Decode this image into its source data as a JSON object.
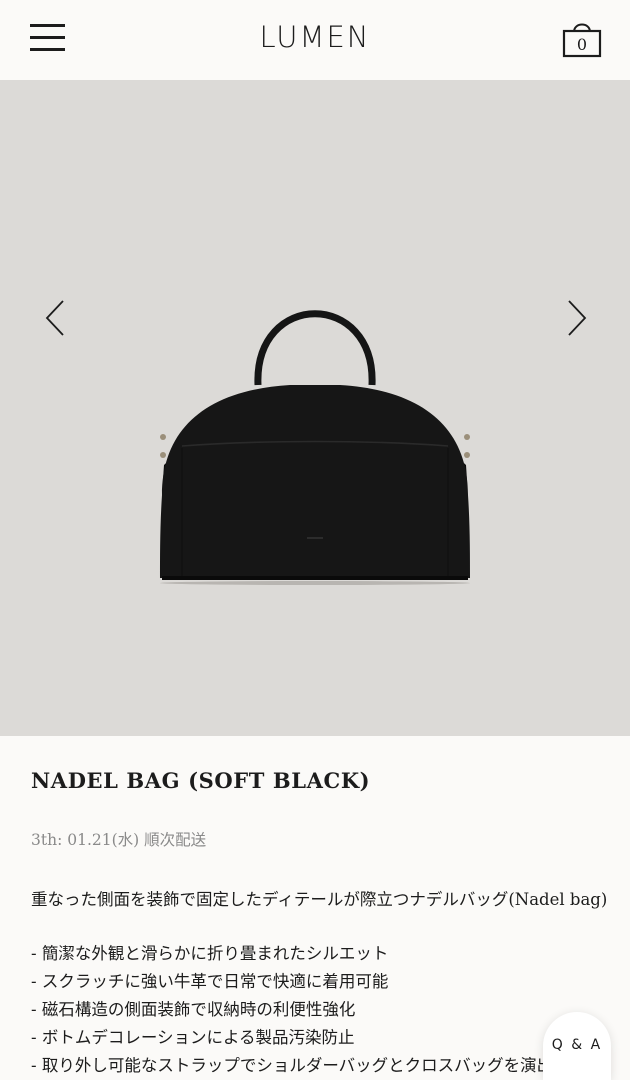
{
  "header": {
    "logo": "LUMEN",
    "menu_icon": "hamburger-menu-icon",
    "cart_icon": "shopping-bag-icon",
    "cart_count": "0"
  },
  "gallery": {
    "background_color": "#dcdad7",
    "prev_icon": "chevron-left-icon",
    "next_icon": "chevron-right-icon",
    "image_alt": "product-photo-black-leather-handbag"
  },
  "product": {
    "name": "NADEL BAG (SOFT BLACK)",
    "shipping": "3th: 01.21(水) 順次配送",
    "lead": "重なった側面を装飾で固定したディテールが際立つナデルバッグ(Nadel bag)",
    "features": [
      "- 簡潔な外観と滑らかに折り畳まれたシルエット",
      "- スクラッチに強い牛革で日常で快適に着用可能",
      "- 磁石構造の側面装飾で収納時の利便性強化",
      "- ボトムデコレーションによる製品汚染防止",
      "- 取り外し可能なストラップでショルダーバッグとクロスバッグを演出可能"
    ]
  },
  "qa": {
    "label": "Q & A"
  }
}
